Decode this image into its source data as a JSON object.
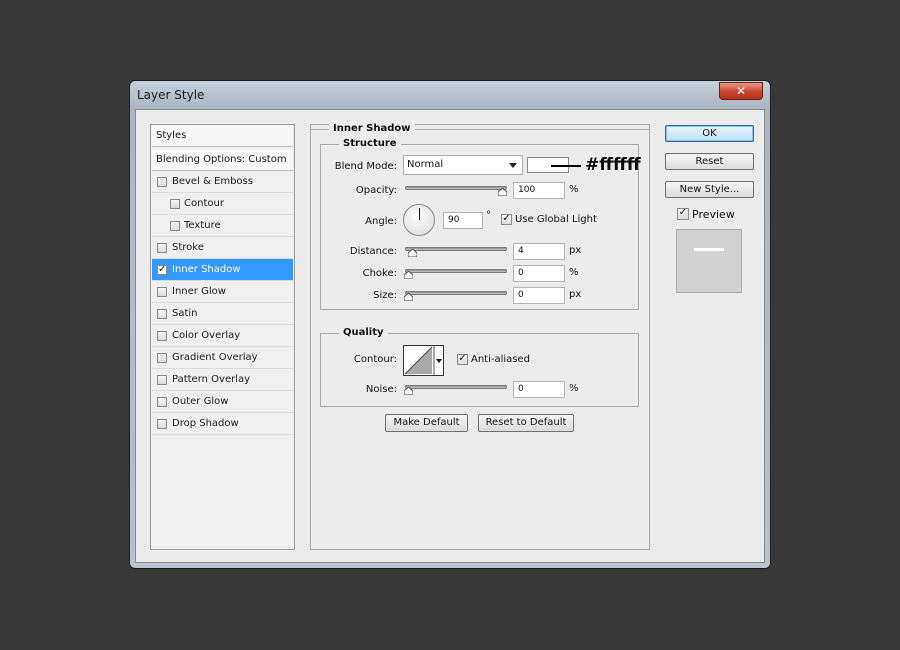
{
  "window": {
    "title": "Layer Style",
    "close_glyph": "✕"
  },
  "styles_list": {
    "header": "Styles",
    "blending": "Blending Options: Custom",
    "items": [
      {
        "label": "Bevel & Emboss",
        "checked": false,
        "indent": false
      },
      {
        "label": "Contour",
        "checked": false,
        "indent": true
      },
      {
        "label": "Texture",
        "checked": false,
        "indent": true
      },
      {
        "label": "Stroke",
        "checked": false,
        "indent": false
      },
      {
        "label": "Inner Shadow",
        "checked": true,
        "indent": false,
        "selected": true
      },
      {
        "label": "Inner Glow",
        "checked": false,
        "indent": false
      },
      {
        "label": "Satin",
        "checked": false,
        "indent": false
      },
      {
        "label": "Color Overlay",
        "checked": false,
        "indent": false
      },
      {
        "label": "Gradient Overlay",
        "checked": false,
        "indent": false
      },
      {
        "label": "Pattern Overlay",
        "checked": false,
        "indent": false
      },
      {
        "label": "Outer Glow",
        "checked": false,
        "indent": false
      },
      {
        "label": "Drop Shadow",
        "checked": false,
        "indent": false
      }
    ]
  },
  "inner_shadow": {
    "section_title": "Inner Shadow",
    "structure": {
      "title": "Structure",
      "blend_mode_label": "Blend Mode:",
      "blend_mode_value": "Normal",
      "shadow_color": "#ffffff",
      "color_annotation": "#ffffff",
      "opacity_label": "Opacity:",
      "opacity_value": "100",
      "opacity_unit": "%",
      "opacity_level": 1.0,
      "angle_label": "Angle:",
      "angle_value": "90",
      "angle_unit": "°",
      "use_global_light_label": "Use Global Light",
      "use_global_light": true,
      "distance_label": "Distance:",
      "distance_value": "4",
      "distance_unit": "px",
      "distance_level": 0.04,
      "choke_label": "Choke:",
      "choke_value": "0",
      "choke_unit": "%",
      "choke_level": 0,
      "size_label": "Size:",
      "size_value": "0",
      "size_unit": "px",
      "size_level": 0
    },
    "quality": {
      "title": "Quality",
      "contour_label": "Contour:",
      "anti_aliased_label": "Anti-aliased",
      "anti_aliased": true,
      "noise_label": "Noise:",
      "noise_value": "0",
      "noise_unit": "%",
      "noise_level": 0
    },
    "make_default_label": "Make Default",
    "reset_default_label": "Reset to Default"
  },
  "actions": {
    "ok_label": "OK",
    "reset_label": "Reset",
    "new_style_label": "New Style...",
    "preview_label": "Preview",
    "preview_checked": true
  }
}
